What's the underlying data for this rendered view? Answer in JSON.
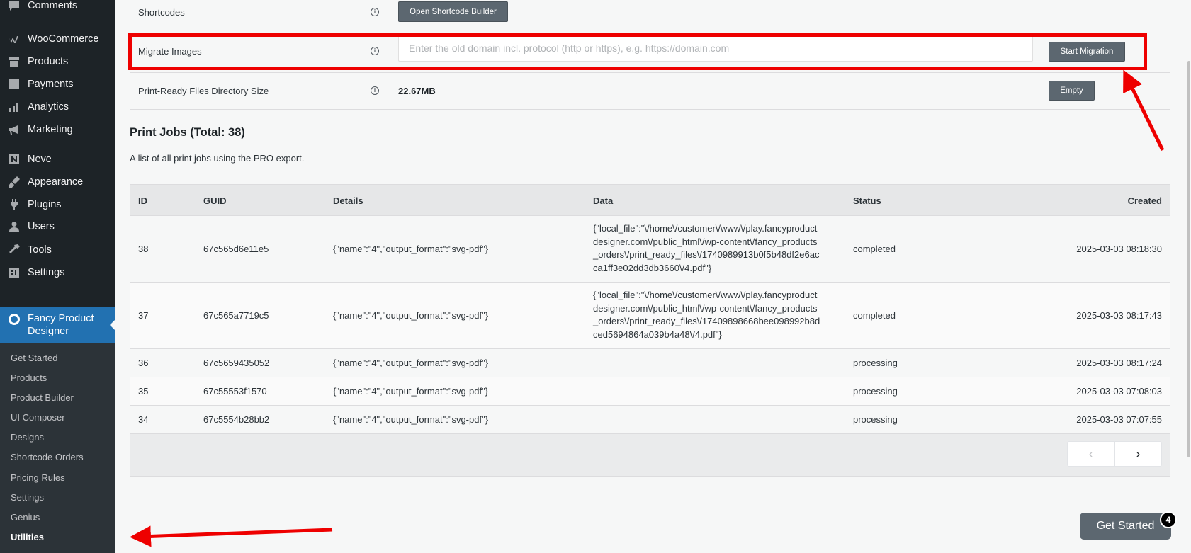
{
  "sidebar": {
    "items": [
      {
        "label": "Comments",
        "icon": "comments-icon"
      },
      {
        "label": "WooCommerce",
        "icon": "woocommerce-icon"
      },
      {
        "label": "Products",
        "icon": "products-icon"
      },
      {
        "label": "Payments",
        "icon": "payments-icon"
      },
      {
        "label": "Analytics",
        "icon": "analytics-icon"
      },
      {
        "label": "Marketing",
        "icon": "marketing-icon"
      },
      {
        "label": "Neve",
        "icon": "neve-icon"
      },
      {
        "label": "Appearance",
        "icon": "appearance-icon"
      },
      {
        "label": "Plugins",
        "icon": "plugins-icon"
      },
      {
        "label": "Users",
        "icon": "users-icon"
      },
      {
        "label": "Tools",
        "icon": "tools-icon"
      },
      {
        "label": "Settings",
        "icon": "settings-icon"
      }
    ],
    "active": {
      "label": "Fancy Product Designer",
      "icon": "fancy-product-designer-icon"
    },
    "submenu": [
      "Get Started",
      "Products",
      "Product Builder",
      "UI Composer",
      "Designs",
      "Shortcode Orders",
      "Pricing Rules",
      "Settings",
      "Genius",
      "Utilities"
    ],
    "current_submenu": "Utilities"
  },
  "utilities": {
    "shortcodes": {
      "label": "Shortcodes",
      "button": "Open Shortcode Builder"
    },
    "migrate": {
      "label": "Migrate Images",
      "placeholder": "Enter the old domain incl. protocol (http or https), e.g. https://domain.com",
      "button": "Start Migration"
    },
    "print_ready": {
      "label": "Print-Ready Files Directory Size",
      "value": "22.67MB",
      "button": "Empty"
    }
  },
  "print_jobs": {
    "title": "Print Jobs (Total: 38)",
    "description": "A list of all print jobs using the PRO export.",
    "columns": [
      "ID",
      "GUID",
      "Details",
      "Data",
      "Status",
      "Created"
    ],
    "rows": [
      {
        "id": "38",
        "guid": "67c565d6e11e5",
        "details": "{\"name\":\"4\",\"output_format\":\"svg-pdf\"}",
        "data": [
          "{\"local_file\":\"\\/home\\/customer\\/www\\/play.fancyproduct",
          "designer.com\\/public_html\\/wp-content\\/fancy_products",
          "_orders\\/print_ready_files\\/1740989913b0f5b48df2e6ac",
          "ca1ff3e02dd3db3660\\/4.pdf\"}"
        ],
        "status": "completed",
        "created": "2025-03-03 08:18:30"
      },
      {
        "id": "37",
        "guid": "67c565a7719c5",
        "details": "{\"name\":\"4\",\"output_format\":\"svg-pdf\"}",
        "data": [
          "{\"local_file\":\"\\/home\\/customer\\/www\\/play.fancyproduct",
          "designer.com\\/public_html\\/wp-content\\/fancy_products",
          "_orders\\/print_ready_files\\/17409898668bee098992b8d",
          "ced5694864a039b4a48\\/4.pdf\"}"
        ],
        "status": "completed",
        "created": "2025-03-03 08:17:43"
      },
      {
        "id": "36",
        "guid": "67c5659435052",
        "details": "{\"name\":\"4\",\"output_format\":\"svg-pdf\"}",
        "data": [],
        "status": "processing",
        "created": "2025-03-03 08:17:24"
      },
      {
        "id": "35",
        "guid": "67c55553f1570",
        "details": "{\"name\":\"4\",\"output_format\":\"svg-pdf\"}",
        "data": [],
        "status": "processing",
        "created": "2025-03-03 07:08:03"
      },
      {
        "id": "34",
        "guid": "67c5554b28bb2",
        "details": "{\"name\":\"4\",\"output_format\":\"svg-pdf\"}",
        "data": [],
        "status": "processing",
        "created": "2025-03-03 07:07:55"
      }
    ],
    "pager": {
      "prev": "‹",
      "next": "›"
    }
  },
  "get_started": {
    "label": "Get Started",
    "badge": "4"
  },
  "colors": {
    "admin_bg": "#1d2327",
    "accent": "#2271b1",
    "button": "#5c6770",
    "annotation": "#ee0000"
  }
}
